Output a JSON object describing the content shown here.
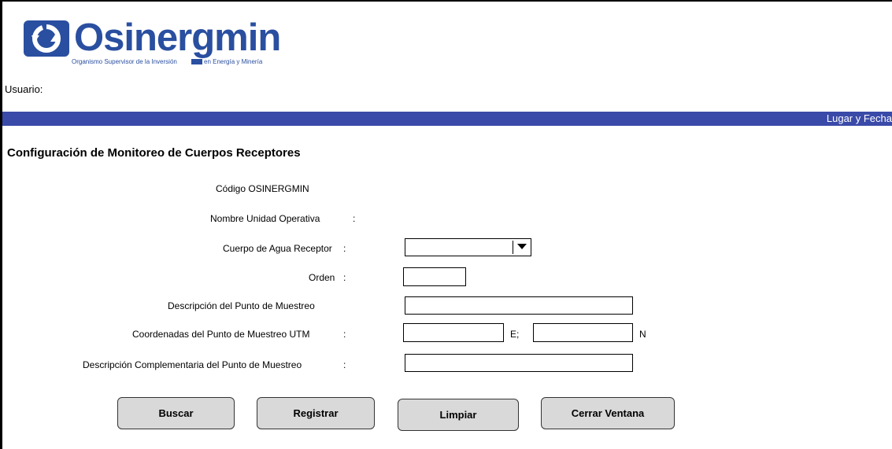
{
  "logo": {
    "name": "Osinergmin",
    "tagline_left": "Organismo Supervisor de la Inversión",
    "tagline_right": "en Energía y Minería"
  },
  "header": {
    "user_label": "Usuario:",
    "place_date_label": "Lugar y Fecha"
  },
  "page_title": "Configuración de Monitoreo de Cuerpos Receptores",
  "form": {
    "codigo_label": "Código OSINERGMIN",
    "nombre_label": "Nombre Unidad Operativa",
    "nombre_colon": ":",
    "cuerpo_label": "Cuerpo de Agua Receptor",
    "cuerpo_colon": ":",
    "cuerpo_value": "",
    "orden_label": "Orden",
    "orden_colon": ":",
    "orden_value": "",
    "descripcion_label": "Descripción del Punto de Muestreo",
    "descripcion_value": "",
    "coordenadas_label": "Coordenadas del Punto de Muestreo UTM",
    "coordenadas_colon": ":",
    "este_value": "",
    "este_suffix": "E;",
    "norte_value": "",
    "norte_suffix": "N",
    "complementaria_label": "Descripción Complementaria del Punto de Muestreo",
    "complementaria_colon": ":",
    "complementaria_value": ""
  },
  "buttons": {
    "buscar": "Buscar",
    "registrar": "Registrar",
    "limpiar": "Limpiar",
    "cerrar": "Cerrar Ventana"
  },
  "colors": {
    "header_bar": "#3a4aa8",
    "logo_blue": "#2a4fa0",
    "button_bg": "#d9d9d9"
  }
}
